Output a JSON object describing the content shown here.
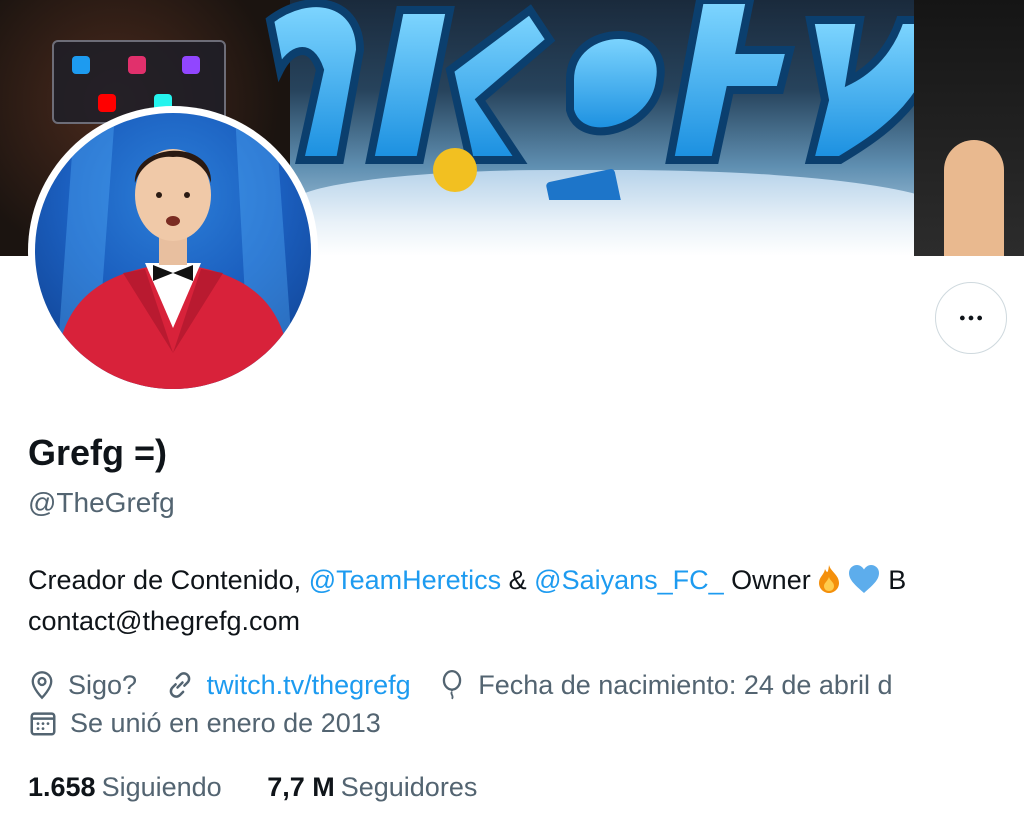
{
  "profile": {
    "display_name": "Grefg =)",
    "handle": "@TheGrefg",
    "bio": {
      "line1_prefix": "Creador de Contenido, ",
      "mention1": "@TeamHeretics",
      "amp": " & ",
      "mention2": "@Saiyans_FC_",
      "line1_suffix": " Owner",
      "line1_overflow": " B",
      "line2": "contact@thegrefg.com"
    },
    "location": "Sigo?",
    "website": "twitch.tv/thegrefg",
    "birthday": "Fecha de nacimiento: 24 de abril d",
    "joined": "Se unió en enero de 2013",
    "following_count": "1.658",
    "following_label": "Siguiendo",
    "followers_count": "7,7 M",
    "followers_label": "Seguidores"
  },
  "icons": {
    "more": "more-dots-icon",
    "location": "location-pin-icon",
    "link": "link-icon",
    "birthday": "balloon-icon",
    "calendar": "calendar-icon",
    "fire": "fire-emoji",
    "heart": "blue-heart-emoji"
  },
  "colors": {
    "accent": "#1d9bf0",
    "text_primary": "#0f1419",
    "text_secondary": "#536471",
    "border": "#cfd9de"
  }
}
